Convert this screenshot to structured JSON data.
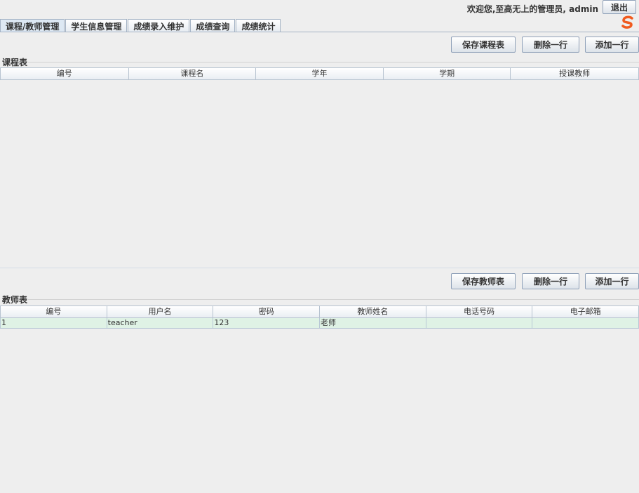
{
  "header": {
    "welcome": "欢迎您,至高无上的管理员, admin",
    "logout_label": "退出"
  },
  "tabs": [
    {
      "label": "课程/教师管理",
      "active": true
    },
    {
      "label": "学生信息管理",
      "active": false
    },
    {
      "label": "成绩录入维护",
      "active": false
    },
    {
      "label": "成绩查询",
      "active": false
    },
    {
      "label": "成绩统计",
      "active": false
    }
  ],
  "course": {
    "save_label": "保存课程表",
    "delete_label": "删除一行",
    "add_label": "添加一行",
    "title": "课程表",
    "columns": [
      "编号",
      "课程名",
      "学年",
      "学期",
      "授课教师"
    ]
  },
  "teacher": {
    "save_label": "保存教师表",
    "delete_label": "删除一行",
    "add_label": "添加一行",
    "title": "教师表",
    "columns": [
      "编号",
      "用户名",
      "密码",
      "教师姓名",
      "电话号码",
      "电子邮箱"
    ],
    "rows": [
      [
        "1",
        "teacher",
        "123",
        "老师",
        "",
        ""
      ]
    ]
  }
}
